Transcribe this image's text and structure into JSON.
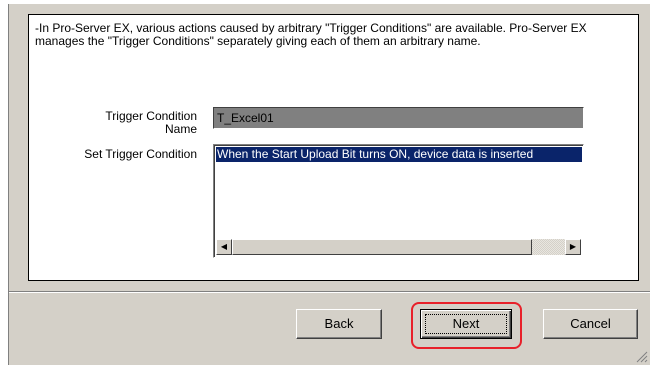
{
  "description": "-In Pro-Server EX, various actions caused by arbitrary \"Trigger Conditions\" are available. Pro-Server EX manages the \"Trigger Conditions\" separately giving each of them an arbitrary name.",
  "form": {
    "name_label": "Trigger Condition Name",
    "name_value": "T_Excel01",
    "condition_label": "Set Trigger Condition",
    "condition_items": [
      "When the Start Upload Bit turns ON, device data is inserted"
    ]
  },
  "buttons": {
    "back": "Back",
    "next": "Next",
    "cancel": "Cancel"
  },
  "icons": {
    "scroll_left": "scroll-left-arrow-icon",
    "scroll_right": "scroll-right-arrow-icon",
    "resize_grip": "resize-grip-icon"
  },
  "colors": {
    "dialog_bg": "#d4d0c8",
    "selection_bg": "#0a246a",
    "highlight_ring": "#e8202a"
  }
}
